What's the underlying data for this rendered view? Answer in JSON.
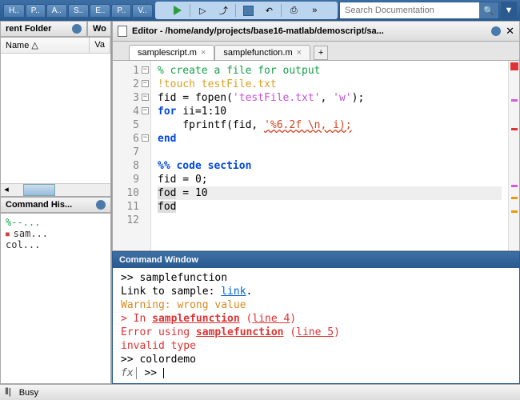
{
  "toolbar": {
    "mini_tabs": [
      "H..",
      "P..",
      "A..",
      "S..",
      "E..",
      "P..",
      "V.."
    ],
    "search_placeholder": "Search Documentation"
  },
  "folder_panel": {
    "title_truncated": "rent Folder",
    "right_tab": "Wo",
    "columns": {
      "name": "Name △",
      "val": "Va"
    }
  },
  "history_panel": {
    "title": "Command His...",
    "items": [
      {
        "text": "%--...",
        "comment": true,
        "bullet": false
      },
      {
        "text": "sam...",
        "comment": false,
        "bullet": true
      },
      {
        "text": "col...",
        "comment": false,
        "bullet": false
      }
    ]
  },
  "editor": {
    "title": "Editor - /home/andy/projects/base16-matlab/demoscript/sa...",
    "tabs": [
      {
        "label": "samplescript.m",
        "active": true
      },
      {
        "label": "samplefunction.m",
        "active": false
      }
    ],
    "lines": [
      {
        "n": 1,
        "fold": "-",
        "segs": [
          {
            "t": "% create a file for output",
            "c": "cmt"
          }
        ]
      },
      {
        "n": 2,
        "fold": "-",
        "segs": [
          {
            "t": "!touch testFile.txt",
            "c": "bang"
          }
        ]
      },
      {
        "n": 3,
        "fold": "-",
        "segs": [
          {
            "t": "fid = fopen(",
            "c": ""
          },
          {
            "t": "'testFile.txt'",
            "c": "str"
          },
          {
            "t": ", ",
            "c": ""
          },
          {
            "t": "'w'",
            "c": "str"
          },
          {
            "t": ");",
            "c": ""
          }
        ]
      },
      {
        "n": 4,
        "fold": "⊟",
        "segs": [
          {
            "t": "for ",
            "c": "kw"
          },
          {
            "t": "ii=1:10",
            "c": ""
          }
        ]
      },
      {
        "n": 5,
        "segs": [
          {
            "t": "    fprintf(fid, ",
            "c": ""
          },
          {
            "t": "'%6.2f \\n, i);",
            "c": "err"
          }
        ]
      },
      {
        "n": 6,
        "fold": "-",
        "segs": [
          {
            "t": "end",
            "c": "kw"
          }
        ]
      },
      {
        "n": 7,
        "segs": []
      },
      {
        "n": 8,
        "segs": [
          {
            "t": "%% code section",
            "c": "kw"
          }
        ]
      },
      {
        "n": 9,
        "segs": [
          {
            "t": "fid = 0;",
            "c": ""
          }
        ]
      },
      {
        "n": 10,
        "hl": true,
        "segs": [
          {
            "t": "fod",
            "c": "hl-word"
          },
          {
            "t": " = 10",
            "c": ""
          }
        ]
      },
      {
        "n": 11,
        "segs": [
          {
            "t": "fod",
            "c": "hl-word"
          }
        ]
      },
      {
        "n": 12,
        "segs": []
      }
    ]
  },
  "command_window": {
    "title": "Command Window",
    "lines": [
      [
        {
          "t": ">> samplefunction"
        }
      ],
      [
        {
          "t": "Link to sample: "
        },
        {
          "t": "link",
          "c": "link"
        },
        {
          "t": "."
        }
      ],
      [
        {
          "t": "Warning: wrong value",
          "c": "warn"
        }
      ],
      [
        {
          "t": "> In ",
          "c": "errln"
        },
        {
          "t": "samplefunction",
          "c": "errln strong"
        },
        {
          "t": " (",
          "c": "errln"
        },
        {
          "t": "line 4",
          "c": "errln link"
        },
        {
          "t": ")",
          "c": "errln"
        }
      ],
      [
        {
          "t": "Error using ",
          "c": "errln"
        },
        {
          "t": "samplefunction",
          "c": "errln strong"
        },
        {
          "t": " (",
          "c": "errln"
        },
        {
          "t": "line 5",
          "c": "errln link"
        },
        {
          "t": ")",
          "c": "errln"
        }
      ],
      [
        {
          "t": "invalid type",
          "c": "errln"
        }
      ],
      [
        {
          "t": ">> colordemo"
        }
      ]
    ],
    "prompt_prefix": "fx"
  },
  "statusbar": {
    "text": "Busy"
  }
}
